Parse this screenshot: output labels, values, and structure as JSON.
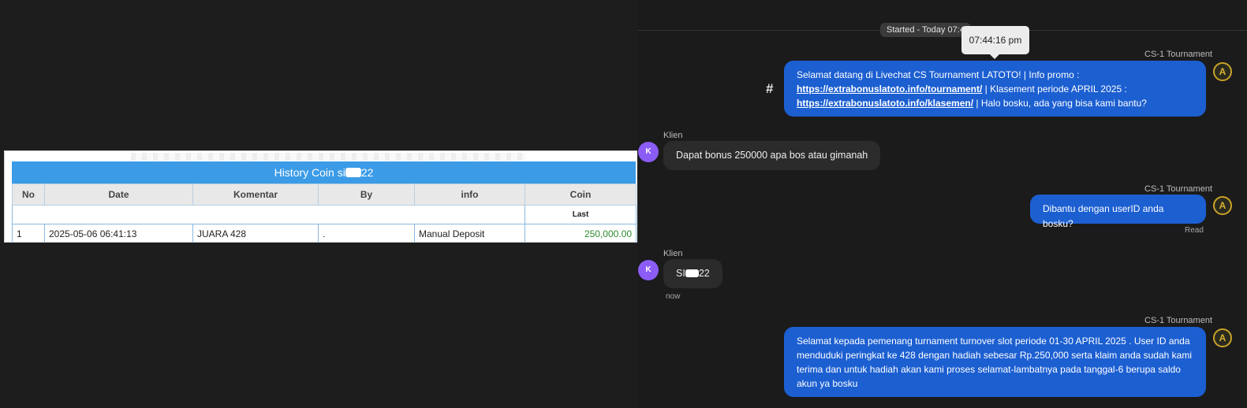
{
  "history": {
    "title_prefix": "History Coin si",
    "title_suffix": "22",
    "columns": [
      "No",
      "Date",
      "Komentar",
      "By",
      "info",
      "Coin"
    ],
    "sub_header": "Last",
    "rows": [
      {
        "no": "1",
        "date": "2025-05-06 06:41:13",
        "komentar": "JUARA 428",
        "by": ".",
        "info": "Manual Deposit",
        "coin": "250,000.00"
      }
    ]
  },
  "chat": {
    "started_label": "Started - Today 07:4",
    "tooltip_time": "07:44:16 pm",
    "agent_name": "CS-1 Tournament",
    "client_name": "Klien",
    "client_avatar_letter": "K",
    "agent_avatar_letter": "A",
    "hash_symbol": "#",
    "messages": {
      "m1": {
        "part1": "Selamat datang di Livechat CS Tournament LATOTO! | Info promo :",
        "link1": "https://extrabonuslatoto.info/tournament/",
        "part2": " | Klasement periode APRIL 2025 :",
        "link2": "https://extrabonuslatoto.info/klasemen/",
        "part3": " | Halo bosku, ada yang bisa kami bantu?"
      },
      "m2": "Dapat bonus 250000 apa bos atau gimanah",
      "m3": "Dibantu dengan userID anda bosku?",
      "m3_status": "Read",
      "m4_prefix": "SI",
      "m4_suffix": "22",
      "m4_time": "now",
      "m5": "Selamat kepada pemenang turnament turnover slot periode 01-30 APRIL 2025 . User ID anda menduduki peringkat ke 428 dengan hadiah sebesar Rp.250,000 serta klaim anda sudah kami terima dan untuk hadiah akan kami proses selamat-lambatnya pada tanggal-6 berupa saldo akun ya bosku"
    }
  },
  "colors": {
    "agent_bubble": "#1c5fd1",
    "client_bubble": "#2b2b2b",
    "table_header": "#3b9be7",
    "coin_value": "#2e8b2e",
    "client_avatar": "#8b5cf6",
    "agent_avatar_ring": "#c9a227"
  }
}
